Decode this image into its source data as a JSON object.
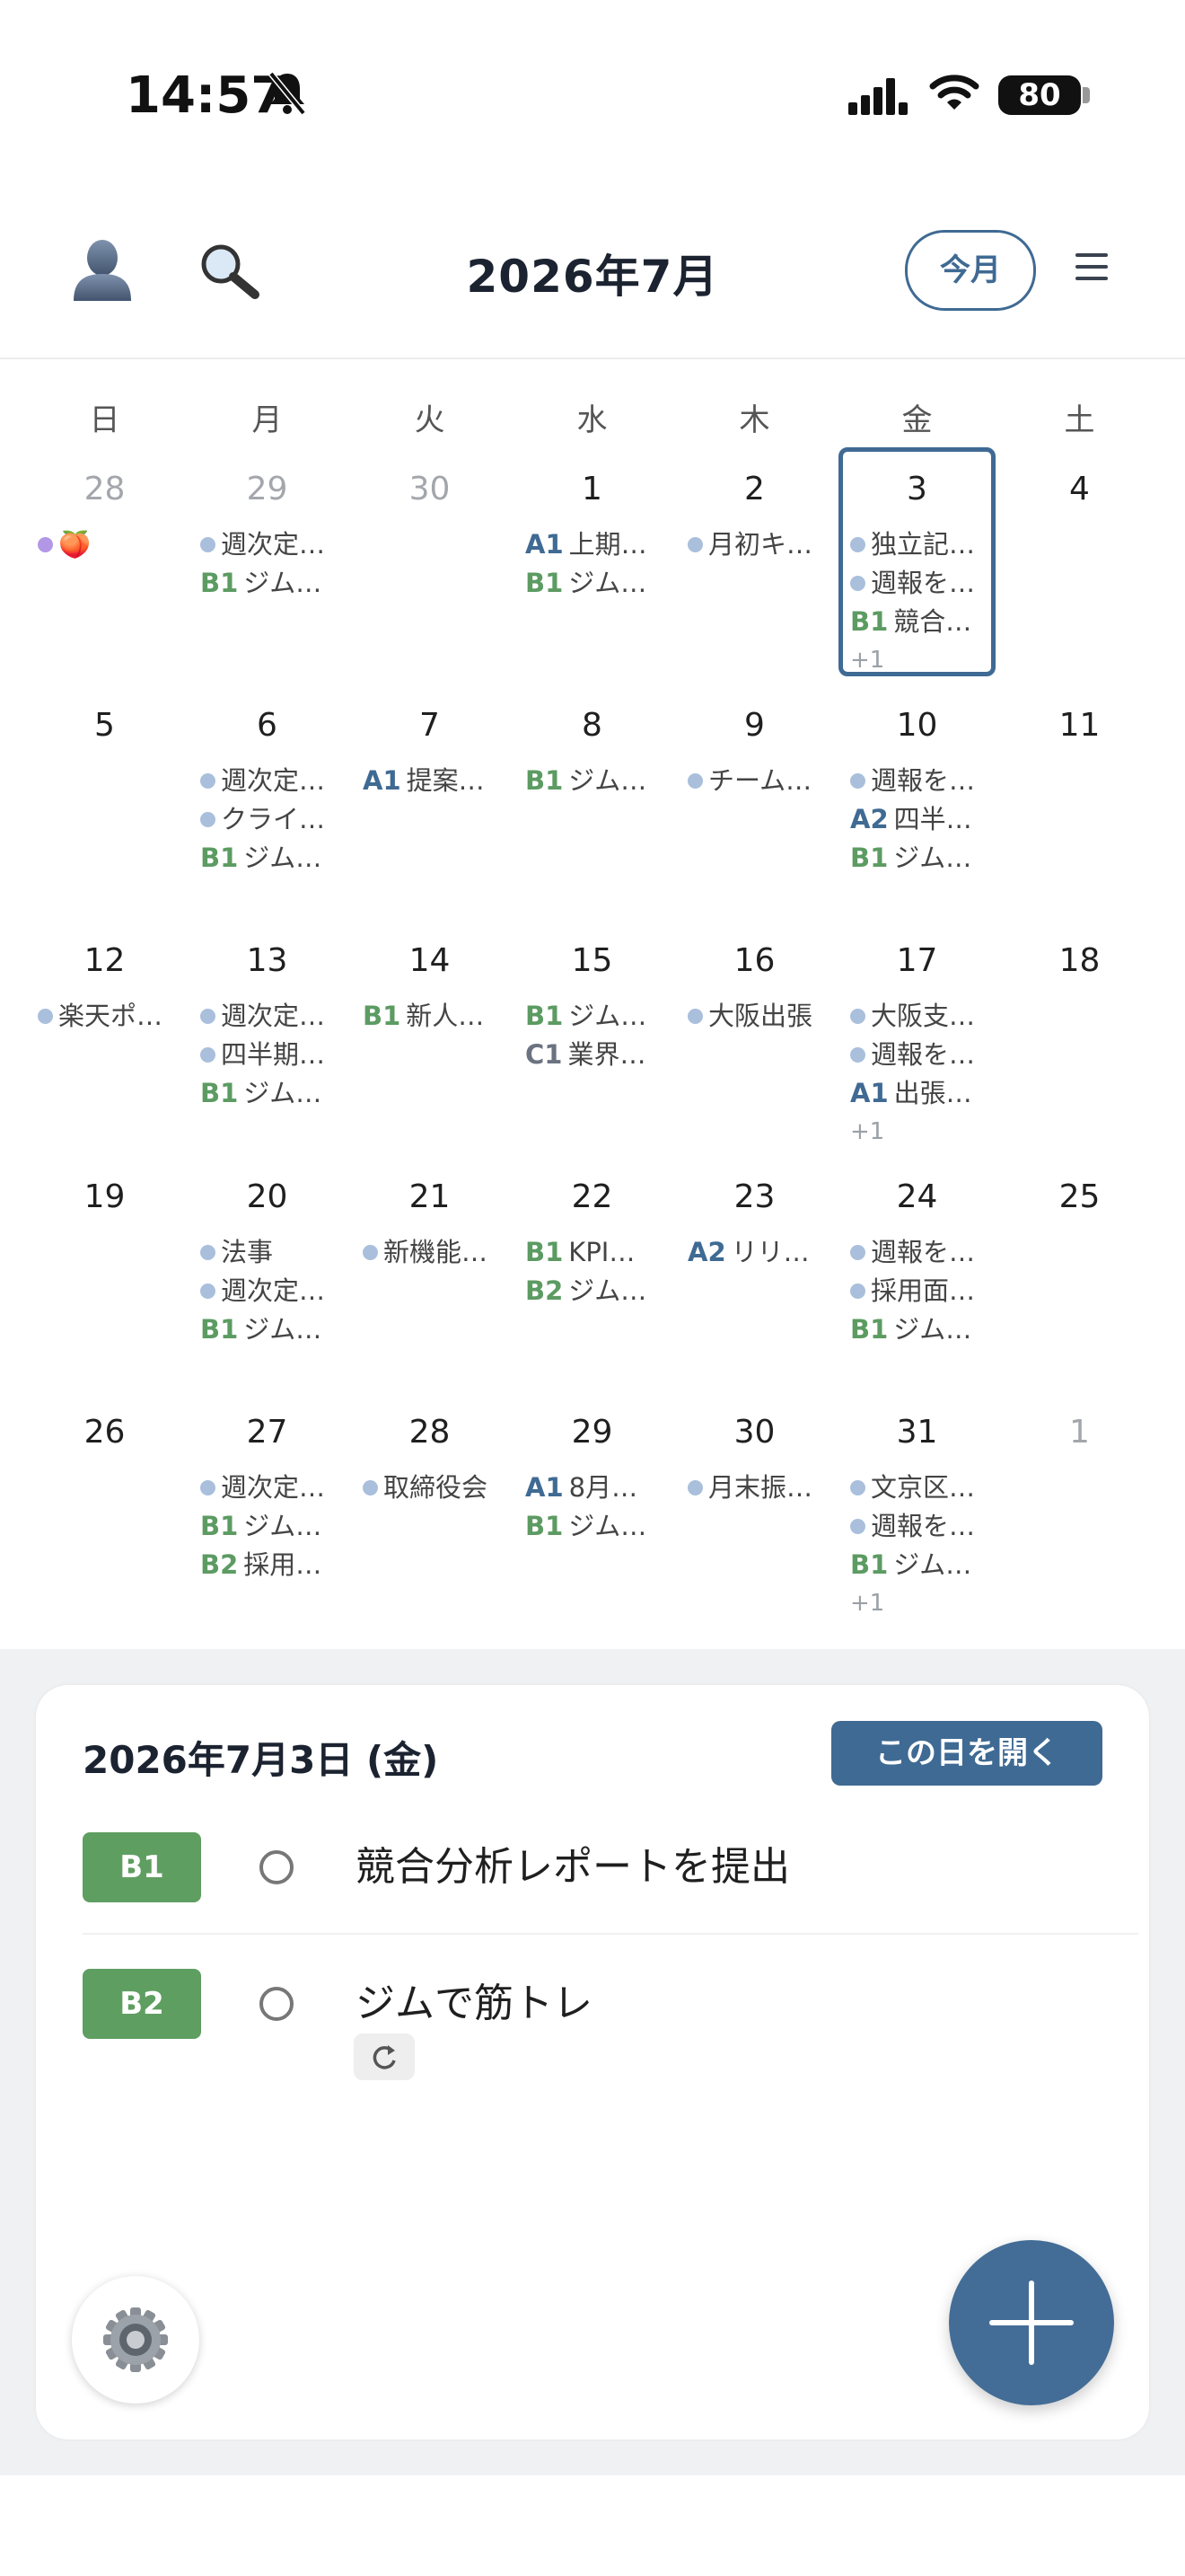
{
  "status": {
    "time": "14:57",
    "battery": "80"
  },
  "header": {
    "title": "2026年7月",
    "today_label": "今月"
  },
  "weekdays": [
    "日",
    "月",
    "火",
    "水",
    "木",
    "金",
    "土"
  ],
  "weeks": [
    [
      {
        "day": "28",
        "muted": true,
        "events": [
          {
            "dot": "purple",
            "text": "🍑"
          }
        ]
      },
      {
        "day": "29",
        "muted": true,
        "events": [
          {
            "dot": "blue",
            "text": "週次定…"
          },
          {
            "pri": "B1",
            "text": "ジム…"
          }
        ]
      },
      {
        "day": "30",
        "muted": true,
        "events": []
      },
      {
        "day": "1",
        "events": [
          {
            "pri": "A1",
            "text": "上期…"
          },
          {
            "pri": "B1",
            "text": "ジム…"
          }
        ]
      },
      {
        "day": "2",
        "events": [
          {
            "dot": "blue",
            "text": "月初キ…"
          }
        ]
      },
      {
        "day": "3",
        "selected": true,
        "events": [
          {
            "dot": "blue",
            "text": "独立記…"
          },
          {
            "dot": "blue",
            "text": "週報を…"
          },
          {
            "pri": "B1",
            "text": "競合…"
          }
        ],
        "more": "+1"
      },
      {
        "day": "4",
        "events": []
      }
    ],
    [
      {
        "day": "5",
        "events": []
      },
      {
        "day": "6",
        "events": [
          {
            "dot": "blue",
            "text": "週次定…"
          },
          {
            "dot": "blue",
            "text": "クライ…"
          },
          {
            "pri": "B1",
            "text": "ジム…"
          }
        ]
      },
      {
        "day": "7",
        "events": [
          {
            "pri": "A1",
            "text": "提案…"
          }
        ]
      },
      {
        "day": "8",
        "events": [
          {
            "pri": "B1",
            "text": "ジム…"
          }
        ]
      },
      {
        "day": "9",
        "events": [
          {
            "dot": "blue",
            "text": "チーム…"
          }
        ]
      },
      {
        "day": "10",
        "events": [
          {
            "dot": "blue",
            "text": "週報を…"
          },
          {
            "pri": "A2",
            "text": "四半…"
          },
          {
            "pri": "B1",
            "text": "ジム…"
          }
        ]
      },
      {
        "day": "11",
        "events": []
      }
    ],
    [
      {
        "day": "12",
        "events": [
          {
            "dot": "blue",
            "text": "楽天ポ…"
          }
        ]
      },
      {
        "day": "13",
        "events": [
          {
            "dot": "blue",
            "text": "週次定…"
          },
          {
            "dot": "blue",
            "text": "四半期…"
          },
          {
            "pri": "B1",
            "text": "ジム…"
          }
        ]
      },
      {
        "day": "14",
        "events": [
          {
            "pri": "B1",
            "text": "新人…"
          }
        ]
      },
      {
        "day": "15",
        "events": [
          {
            "pri": "B1",
            "text": "ジム…"
          },
          {
            "pri": "C1",
            "text": "業界…"
          }
        ]
      },
      {
        "day": "16",
        "events": [
          {
            "dot": "blue",
            "text": "大阪出張"
          }
        ]
      },
      {
        "day": "17",
        "events": [
          {
            "dot": "blue",
            "text": "大阪支…"
          },
          {
            "dot": "blue",
            "text": "週報を…"
          },
          {
            "pri": "A1",
            "text": "出張…"
          }
        ],
        "more": "+1"
      },
      {
        "day": "18",
        "events": []
      }
    ],
    [
      {
        "day": "19",
        "events": []
      },
      {
        "day": "20",
        "events": [
          {
            "dot": "blue",
            "text": "法事"
          },
          {
            "dot": "blue",
            "text": "週次定…"
          },
          {
            "pri": "B1",
            "text": "ジム…"
          }
        ]
      },
      {
        "day": "21",
        "events": [
          {
            "dot": "blue",
            "text": "新機能…"
          }
        ]
      },
      {
        "day": "22",
        "events": [
          {
            "pri": "B1",
            "text": "KPI…"
          },
          {
            "pri": "B2",
            "text": "ジム…"
          }
        ]
      },
      {
        "day": "23",
        "events": [
          {
            "pri": "A2",
            "text": "リリ…"
          }
        ]
      },
      {
        "day": "24",
        "events": [
          {
            "dot": "blue",
            "text": "週報を…"
          },
          {
            "dot": "blue",
            "text": "採用面…"
          },
          {
            "pri": "B1",
            "text": "ジム…"
          }
        ]
      },
      {
        "day": "25",
        "events": []
      }
    ],
    [
      {
        "day": "26",
        "events": []
      },
      {
        "day": "27",
        "events": [
          {
            "dot": "blue",
            "text": "週次定…"
          },
          {
            "pri": "B1",
            "text": "ジム…"
          },
          {
            "pri": "B2",
            "text": "採用…"
          }
        ]
      },
      {
        "day": "28",
        "events": [
          {
            "dot": "blue",
            "text": "取締役会"
          }
        ]
      },
      {
        "day": "29",
        "events": [
          {
            "pri": "A1",
            "text": "8月…"
          },
          {
            "pri": "B1",
            "text": "ジム…"
          }
        ]
      },
      {
        "day": "30",
        "events": [
          {
            "dot": "blue",
            "text": "月末振…"
          }
        ]
      },
      {
        "day": "31",
        "events": [
          {
            "dot": "blue",
            "text": "文京区…"
          },
          {
            "dot": "blue",
            "text": "週報を…"
          },
          {
            "pri": "B1",
            "text": "ジム…"
          }
        ],
        "more": "+1"
      },
      {
        "day": "1",
        "muted": true,
        "events": []
      }
    ]
  ],
  "detail": {
    "date": "2026年7月3日 (金)",
    "open_label": "この日を開く",
    "tasks": [
      {
        "badge": "B1",
        "title": "競合分析レポートを提出",
        "repeat": false
      },
      {
        "badge": "B2",
        "title": "ジムで筋トレ",
        "repeat": true
      }
    ]
  },
  "icons": {
    "person": "person-icon",
    "search": "search-icon",
    "menu": "menu-icon",
    "gear": "gear-icon",
    "plus": "plus-icon",
    "repeat": "repeat-icon"
  },
  "colors": {
    "accent": "#3f6a93",
    "green": "#5f9e61",
    "dot": "#a9bfdc"
  }
}
